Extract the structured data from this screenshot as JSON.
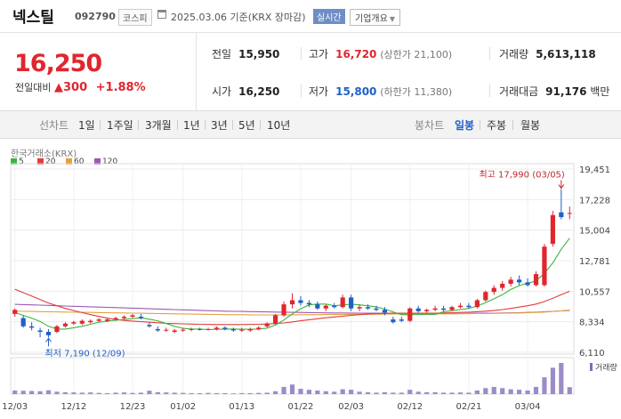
{
  "header": {
    "name": "넥스틸",
    "code": "092790",
    "market": "코스피",
    "date": "2025.03.06 기준(KRX 장마감)",
    "realtime_label": "실시간",
    "company_info_label": "기업개요"
  },
  "price": {
    "current": "16,250",
    "change_label": "전일대비",
    "change": "300",
    "change_pct": "+1.88%"
  },
  "stats": {
    "prev_label": "전일",
    "prev": "15,950",
    "high_label": "고가",
    "high": "16,720",
    "upper_limit": "(상한가 21,100)",
    "volume_label": "거래량",
    "volume": "5,613,118",
    "open_label": "시가",
    "open": "16,250",
    "low_label": "저가",
    "low": "15,800",
    "lower_limit": "(하한가 11,380)",
    "value_label": "거래대금",
    "value": "91,176",
    "value_unit": "백만"
  },
  "tabs": {
    "line_label": "선차트",
    "periods": [
      "1일",
      "1주일",
      "3개월",
      "1년",
      "3년",
      "5년",
      "10년"
    ],
    "candle_label": "봉차트",
    "candle_periods": [
      "일봉",
      "주봉",
      "월봉"
    ],
    "active_candle": "일봉"
  },
  "chart_data": {
    "type": "candlestick",
    "exchange_label": "한국거래소(KRX)",
    "legend": [
      {
        "name": "5",
        "color": "#3db63d"
      },
      {
        "name": "20",
        "color": "#e23b3b"
      },
      {
        "name": "60",
        "color": "#e6a23c"
      },
      {
        "name": "120",
        "color": "#9b59b6"
      }
    ],
    "y_ticks": [
      6110,
      8334,
      10557,
      12781,
      15004,
      17228,
      19451
    ],
    "ylim": [
      6110,
      19451
    ],
    "x_ticks": [
      "12/03",
      "12/12",
      "12/23",
      "01/02",
      "01/13",
      "01/22",
      "02/03",
      "02/12",
      "02/21",
      "03/04"
    ],
    "high_annotation": "최고 17,990 (03/05)",
    "low_annotation": "최저 7,190 (12/09)",
    "volume_label": "거래량",
    "candles": [
      [
        8900,
        9300,
        8700,
        9200
      ],
      [
        8600,
        8800,
        7900,
        8000
      ],
      [
        8000,
        8300,
        7700,
        7900
      ],
      [
        7700,
        7900,
        7200,
        7600
      ],
      [
        7600,
        7800,
        7190,
        7350
      ],
      [
        7600,
        8100,
        7500,
        8000
      ],
      [
        8000,
        8300,
        7900,
        8200
      ],
      [
        8200,
        8400,
        8100,
        8300
      ],
      [
        8200,
        8500,
        8100,
        8400
      ],
      [
        8300,
        8500,
        8200,
        8400
      ],
      [
        8400,
        8600,
        8300,
        8500
      ],
      [
        8400,
        8600,
        8300,
        8500
      ],
      [
        8500,
        8700,
        8400,
        8600
      ],
      [
        8600,
        8800,
        8500,
        8700
      ],
      [
        8700,
        8900,
        8600,
        8800
      ],
      [
        8700,
        8900,
        8500,
        8600
      ],
      [
        8100,
        8300,
        7900,
        8000
      ],
      [
        7800,
        8000,
        7600,
        7700
      ],
      [
        7700,
        7900,
        7600,
        7750
      ],
      [
        7600,
        7800,
        7500,
        7700
      ],
      [
        7700,
        7900,
        7600,
        7750
      ],
      [
        7750,
        7900,
        7650,
        7800
      ],
      [
        7800,
        7900,
        7700,
        7750
      ],
      [
        7750,
        7900,
        7700,
        7800
      ],
      [
        7800,
        8000,
        7700,
        7900
      ],
      [
        7900,
        8000,
        7700,
        7800
      ],
      [
        7800,
        7900,
        7600,
        7700
      ],
      [
        7700,
        7900,
        7600,
        7750
      ],
      [
        7700,
        7900,
        7600,
        7800
      ],
      [
        7800,
        8000,
        7700,
        7900
      ],
      [
        8000,
        8300,
        7900,
        8200
      ],
      [
        8200,
        8900,
        8100,
        8800
      ],
      [
        8800,
        9800,
        8700,
        9600
      ],
      [
        9600,
        10400,
        9300,
        9900
      ],
      [
        9900,
        10200,
        9500,
        9700
      ],
      [
        9700,
        9900,
        9400,
        9600
      ],
      [
        9600,
        9800,
        9200,
        9300
      ],
      [
        9300,
        9600,
        9100,
        9500
      ],
      [
        9500,
        9700,
        9300,
        9400
      ],
      [
        9400,
        10300,
        9300,
        10100
      ],
      [
        10100,
        10300,
        9100,
        9300
      ],
      [
        9300,
        9600,
        9100,
        9400
      ],
      [
        9400,
        9600,
        9200,
        9300
      ],
      [
        9300,
        9500,
        9100,
        9200
      ],
      [
        9200,
        9400,
        8800,
        9000
      ],
      [
        8500,
        8700,
        8200,
        8300
      ],
      [
        8500,
        8700,
        8300,
        8400
      ],
      [
        8400,
        9400,
        8300,
        9300
      ],
      [
        9300,
        9500,
        9000,
        9100
      ],
      [
        9100,
        9300,
        9000,
        9200
      ],
      [
        9200,
        9500,
        9100,
        9300
      ],
      [
        9300,
        9500,
        9100,
        9200
      ],
      [
        9200,
        9500,
        9100,
        9400
      ],
      [
        9400,
        9700,
        9300,
        9500
      ],
      [
        9500,
        9700,
        9300,
        9400
      ],
      [
        9400,
        10000,
        9300,
        9900
      ],
      [
        9900,
        10600,
        9800,
        10500
      ],
      [
        10500,
        11000,
        10300,
        10800
      ],
      [
        10800,
        11300,
        10600,
        11100
      ],
      [
        11100,
        11600,
        10900,
        11400
      ],
      [
        11400,
        11700,
        11000,
        11200
      ],
      [
        11200,
        11500,
        10900,
        11000
      ],
      [
        11000,
        12000,
        10900,
        11800
      ],
      [
        11000,
        14000,
        10900,
        13800
      ],
      [
        14000,
        16400,
        13800,
        16100
      ],
      [
        16300,
        17990,
        15800,
        15950
      ],
      [
        16250,
        16720,
        15800,
        16250
      ]
    ],
    "ma5": [
      9000,
      8800,
      8600,
      8350,
      8000,
      7800,
      7800,
      7900,
      8000,
      8150,
      8300,
      8380,
      8440,
      8500,
      8560,
      8620,
      8520,
      8400,
      8200,
      8000,
      7850,
      7800,
      7800,
      7760,
      7780,
      7800,
      7800,
      7790,
      7780,
      7800,
      7870,
      8090,
      8460,
      8900,
      9280,
      9560,
      9620,
      9620,
      9500,
      9560,
      9600,
      9560,
      9500,
      9420,
      9260,
      9050,
      8840,
      8840,
      8860,
      8870,
      8860,
      9060,
      9140,
      9220,
      9300,
      9480,
      9720,
      10000,
      10300,
      10680,
      10960,
      11140,
      11300,
      11860,
      12620,
      13610,
      14420
    ],
    "ma20": [
      10700,
      10450,
      10200,
      9950,
      9700,
      9500,
      9300,
      9150,
      9000,
      8850,
      8720,
      8600,
      8500,
      8430,
      8380,
      8340,
      8300,
      8260,
      8220,
      8200,
      8180,
      8160,
      8150,
      8140,
      8130,
      8130,
      8130,
      8130,
      8140,
      8150,
      8170,
      8200,
      8250,
      8320,
      8400,
      8480,
      8550,
      8620,
      8680,
      8740,
      8800,
      8850,
      8890,
      8920,
      8940,
      8950,
      8950,
      8950,
      8950,
      8950,
      8960,
      8970,
      8990,
      9010,
      9030,
      9060,
      9100,
      9150,
      9220,
      9300,
      9400,
      9500,
      9620,
      9800,
      10050,
      10300,
      10550
    ],
    "ma60": [
      9100,
      9090,
      9080,
      9070,
      9060,
      9050,
      9040,
      9030,
      9020,
      9010,
      9000,
      8990,
      8980,
      8970,
      8960,
      8950,
      8940,
      8930,
      8920,
      8910,
      8900,
      8890,
      8880,
      8870,
      8860,
      8850,
      8845,
      8840,
      8835,
      8830,
      8830,
      8830,
      8830,
      8835,
      8840,
      8845,
      8850,
      8855,
      8860,
      8865,
      8870,
      8875,
      8880,
      8885,
      8890,
      8895,
      8900,
      8900,
      8900,
      8900,
      8900,
      8905,
      8910,
      8915,
      8920,
      8925,
      8930,
      8940,
      8950,
      8960,
      8975,
      8990,
      9010,
      9040,
      9080,
      9130,
      9180
    ],
    "ma120": [
      9600,
      9580,
      9560,
      9540,
      9520,
      9500,
      9480,
      9460,
      9440,
      9420,
      9400,
      9380,
      9360,
      9340,
      9320,
      9300,
      9280,
      9260,
      9240,
      9220,
      9200,
      9180,
      9160,
      9140,
      9120,
      9100,
      9090,
      9080,
      9070,
      9060,
      9050,
      9040,
      9030,
      9020,
      9010,
      9000,
      8990,
      8980,
      8975,
      8970,
      8965,
      8960,
      8955,
      8950,
      8945,
      8940,
      8935,
      8930,
      8930,
      8930,
      8930,
      8930,
      8930,
      8935,
      8940,
      8945,
      8950,
      8960,
      8970,
      8980,
      8995,
      9010,
      9030,
      9060,
      9090,
      9120,
      9150
    ],
    "volume": [
      150,
      140,
      130,
      120,
      160,
      100,
      80,
      70,
      60,
      70,
      50,
      40,
      60,
      70,
      50,
      60,
      140,
      80,
      70,
      60,
      50,
      40,
      40,
      50,
      40,
      40,
      30,
      40,
      40,
      50,
      60,
      120,
      300,
      400,
      220,
      180,
      150,
      120,
      100,
      200,
      180,
      100,
      80,
      60,
      80,
      60,
      60,
      180,
      100,
      80,
      80,
      60,
      60,
      70,
      60,
      150,
      250,
      300,
      250,
      200,
      180,
      150,
      300,
      700,
      1100,
      1300,
      290
    ]
  }
}
